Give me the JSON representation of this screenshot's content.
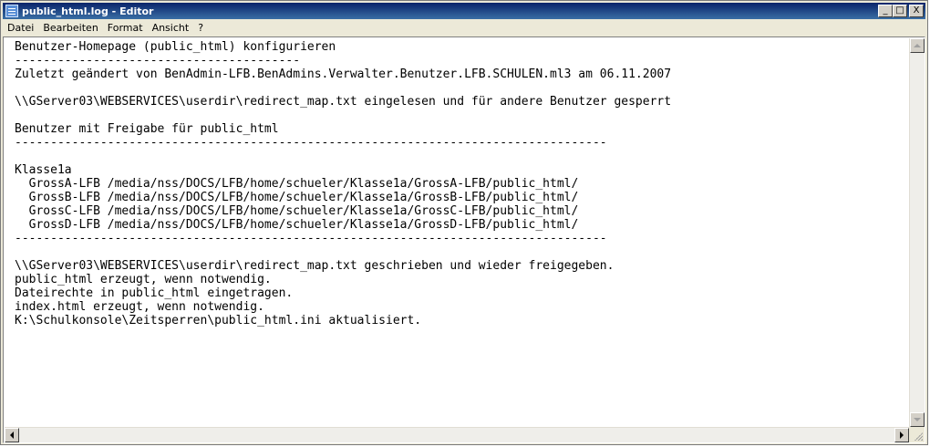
{
  "window": {
    "title": "public_html.log - Editor",
    "minimize_symbol": "_",
    "maximize_symbol": "□",
    "close_symbol": "X"
  },
  "menu": {
    "items": [
      "Datei",
      "Bearbeiten",
      "Format",
      "Ansicht",
      "?"
    ]
  },
  "document": {
    "text": "Benutzer-Homepage (public_html) konfigurieren\n----------------------------------------\nZuletzt geändert von BenAdmin-LFB.BenAdmins.Verwalter.Benutzer.LFB.SCHULEN.ml3 am 06.11.2007\n\n\\\\GServer03\\WEBSERVICES\\userdir\\redirect_map.txt eingelesen und für andere Benutzer gesperrt\n\nBenutzer mit Freigabe für public_html\n-----------------------------------------------------------------------------------\n\nKlasse1a\n  GrossA-LFB /media/nss/DOCS/LFB/home/schueler/Klasse1a/GrossA-LFB/public_html/\n  GrossB-LFB /media/nss/DOCS/LFB/home/schueler/Klasse1a/GrossB-LFB/public_html/\n  GrossC-LFB /media/nss/DOCS/LFB/home/schueler/Klasse1a/GrossC-LFB/public_html/\n  GrossD-LFB /media/nss/DOCS/LFB/home/schueler/Klasse1a/GrossD-LFB/public_html/\n-----------------------------------------------------------------------------------\n\n\\\\GServer03\\WEBSERVICES\\userdir\\redirect_map.txt geschrieben und wieder freigegeben.\npublic_html erzeugt, wenn notwendig.\nDateirechte in public_html eingetragen.\nindex.html erzeugt, wenn notwendig.\nK:\\Schulkonsole\\Zeitsperren\\public_html.ini aktualisiert."
  },
  "icons": {
    "app": "notepad-icon",
    "scroll_up": "arrow-up-icon",
    "scroll_down": "arrow-down-icon",
    "scroll_left": "arrow-left-icon",
    "scroll_right": "arrow-right-icon"
  },
  "colors": {
    "titlebar_start": "#0a246a",
    "titlebar_end": "#3a6ea5",
    "chrome": "#ece9d8",
    "editor_bg": "#ffffff"
  }
}
